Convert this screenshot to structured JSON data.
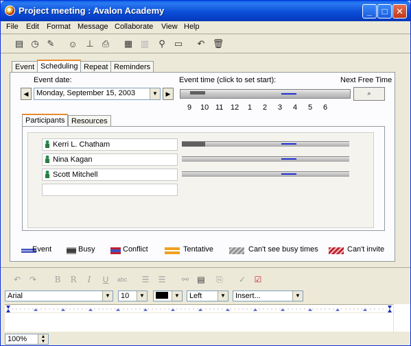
{
  "window": {
    "title": "Project meeting : Avalon Academy",
    "controls": {
      "minimize": "_",
      "maximize": "□",
      "close": "✕"
    }
  },
  "menu": [
    "File",
    "Edit",
    "Format",
    "Message",
    "Collaborate",
    "View",
    "Help"
  ],
  "toolbar": [
    "new-event-icon",
    "alarm-icon",
    "edit-icon",
    "people-icon",
    "stamp-icon",
    "print-icon",
    "calendar-icon",
    "disabled-icon",
    "find-icon",
    "folder-icon",
    "reply-icon",
    "delete-icon"
  ],
  "tabs": [
    "Event",
    "Scheduling",
    "Repeat",
    "Reminders"
  ],
  "scheduling": {
    "event_date_label": "Event date:",
    "event_date": "Monday, September 15, 2003",
    "event_time_label": "Event time (click to set start):",
    "next_free_time_label": "Next Free Time",
    "hours": [
      "9",
      "10",
      "11",
      "12",
      "1",
      "2",
      "3",
      "4",
      "5",
      "6"
    ],
    "subtabs": [
      "Participants",
      "Resources"
    ],
    "participants": [
      "Kerri L. Chatham",
      "Nina Kagan",
      "Scott Mitchell",
      ""
    ]
  },
  "legend": [
    {
      "label": "Event",
      "color": "#4050c0"
    },
    {
      "label": "Busy",
      "color": "#404040"
    },
    {
      "label": "Conflict",
      "color": "#c02030"
    },
    {
      "label": "Tentative",
      "color": "#f0a020"
    },
    {
      "label": "Can't see busy times",
      "color": "#909090"
    },
    {
      "label": "Can't invite",
      "color": "#c02030"
    }
  ],
  "format_bar": {
    "font": "Arial",
    "size": "10",
    "align": "Left",
    "insert": "Insert...",
    "zoom": "100%"
  },
  "colors": {
    "title_bar": "#0a4fd8",
    "accent": "#e68b2c"
  }
}
